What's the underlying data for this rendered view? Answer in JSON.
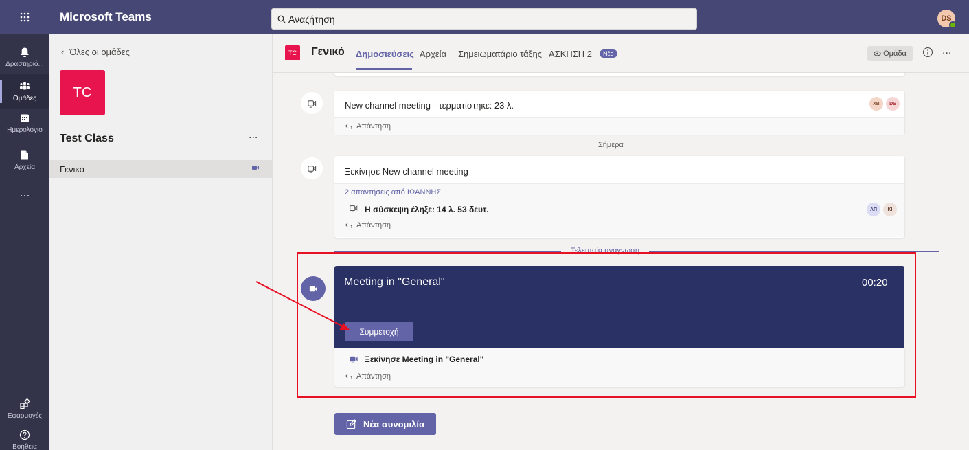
{
  "topbar": {
    "app_title": "Microsoft Teams",
    "search_placeholder": "Αναζήτηση",
    "user_initials": "DS"
  },
  "rail": {
    "items": [
      {
        "label": "Δραστηριό...",
        "icon": "bell-icon"
      },
      {
        "label": "Ομάδες",
        "icon": "teams-icon"
      },
      {
        "label": "Ημερολόγιο",
        "icon": "calendar-icon"
      },
      {
        "label": "Αρχεία",
        "icon": "file-icon"
      }
    ],
    "more": "...",
    "apps_label": "Εφαρμογές",
    "help_label": "Βοήθεια"
  },
  "team_panel": {
    "back_label": "Όλες οι ομάδες",
    "team_initials": "TC",
    "team_name": "Test Class",
    "more": "...",
    "channels": [
      {
        "name": "Γενικό"
      }
    ]
  },
  "channel_header": {
    "initials": "TC",
    "name": "Γενικό",
    "tabs": [
      "Δημοσιεύσεις",
      "Αρχεία",
      "Σημειωματάριο τάξης",
      "ΑΣΚΗΣΗ 2"
    ],
    "new_badge": "Νέο",
    "team_button": "Ομάδα",
    "more": "..."
  },
  "posts": {
    "reply_label": "Απάντηση",
    "post1": {
      "title": "New channel meeting - τερματίστηκε: 23 λ.",
      "avatars": [
        "XB",
        "DS"
      ]
    },
    "today_label": "Σήμερα",
    "post2": {
      "title": "Ξεκίνησε New channel meeting",
      "replies_link": "2 απαντήσεις από ΙΩΑΝΝΗΣ",
      "sub": "Η σύσκεψη έληξε: 14 λ. 53 δευτ.",
      "avatars": [
        "ΑΠ",
        "ΚΙ"
      ]
    },
    "last_read_label": "Τελευταία ανάγνωση",
    "meeting": {
      "title": "Meeting in \"General\"",
      "time": "00:20",
      "join_label": "Συμμετοχή",
      "started": "Ξεκίνησε Meeting in \"General\""
    },
    "new_conversation": "Νέα συνομιλία"
  },
  "colors": {
    "accent": "#6264a7",
    "topbar": "#464775",
    "rail": "#33344a",
    "meeting_bg": "#2a3164",
    "team_red": "#e8144d",
    "annotation_red": "#e81123"
  }
}
